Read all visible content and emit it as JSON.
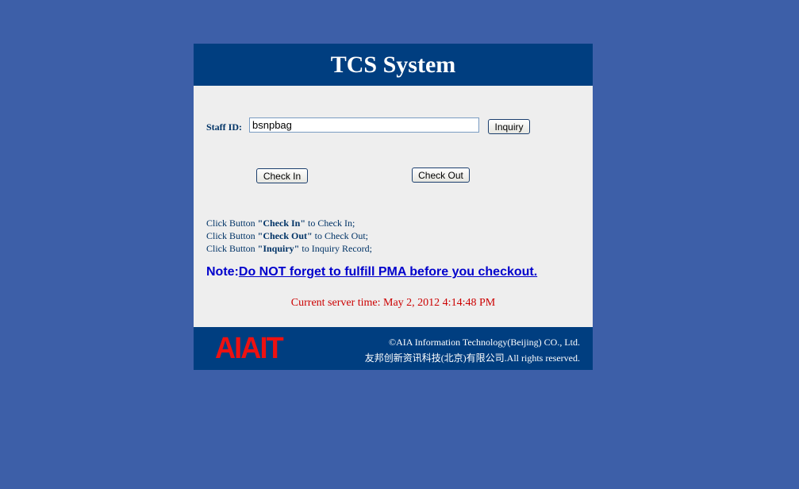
{
  "header": {
    "title": "TCS System"
  },
  "form": {
    "staff_label": "Staff ID:",
    "staff_value": "bsnpbag",
    "inquiry_label": "Inquiry",
    "check_in_label": "Check In",
    "check_out_label": "Check Out"
  },
  "instructions": [
    {
      "prefix": "Click Button ",
      "button": "\"Check In\"",
      "suffix": " to Check In;"
    },
    {
      "prefix": "Click Button ",
      "button": "\"Check Out\"",
      "suffix": " to Check Out;"
    },
    {
      "prefix": "Click Button ",
      "button": "\"Inquiry\"",
      "suffix": " to Inquiry Record;"
    }
  ],
  "note": {
    "label": "Note:",
    "link_text": "Do NOT forget to fulfill PMA before you checkout."
  },
  "server_time": "Current server time: May 2, 2012 4:14:48 PM",
  "footer": {
    "logo": "AIAIT",
    "copyright_line1": "©AIA Information Technology(Beijing) CO., Ltd.",
    "copyright_line2": "友邦创新资讯科技(北京)有限公司.All rights reserved."
  },
  "colors": {
    "page_background": "#3d5fa8",
    "header_background": "#003e80",
    "panel_background": "#eeeeee",
    "note_blue": "#0000cc",
    "time_red": "#cc0000",
    "logo_red": "#ee1111"
  }
}
